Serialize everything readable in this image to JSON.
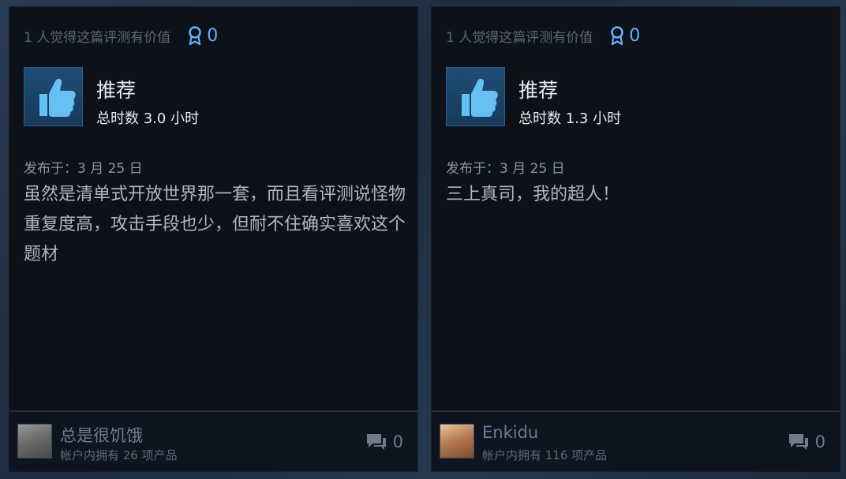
{
  "reviews": [
    {
      "helpful_text": "1 人觉得这篇评测有价值",
      "award_count": "0",
      "recommendation": "推荐",
      "hours": "总时数 3.0 小时",
      "posted": "发布于：3 月 25 日",
      "body": "虽然是清单式开放世界那一套，而且看评测说怪物重复度高，攻击手段也少，但耐不住确实喜欢这个题材",
      "author": "总是很饥饿",
      "products": "帐户内拥有 26 项产品",
      "comment_count": "0"
    },
    {
      "helpful_text": "1 人觉得这篇评测有价值",
      "award_count": "0",
      "recommendation": "推荐",
      "hours": "总时数 1.3 小时",
      "posted": "发布于：3 月 25 日",
      "body": "三上真司，我的超人！",
      "author": "Enkidu",
      "products": "帐户内拥有 116 项产品",
      "comment_count": "0"
    }
  ],
  "icons": {
    "award": "award-ribbon-icon",
    "thumb": "thumbs-up-icon",
    "comment": "comment-bubble-icon"
  },
  "colors": {
    "accent_blue": "#66b0ff",
    "card_bg": "#0c111a"
  }
}
